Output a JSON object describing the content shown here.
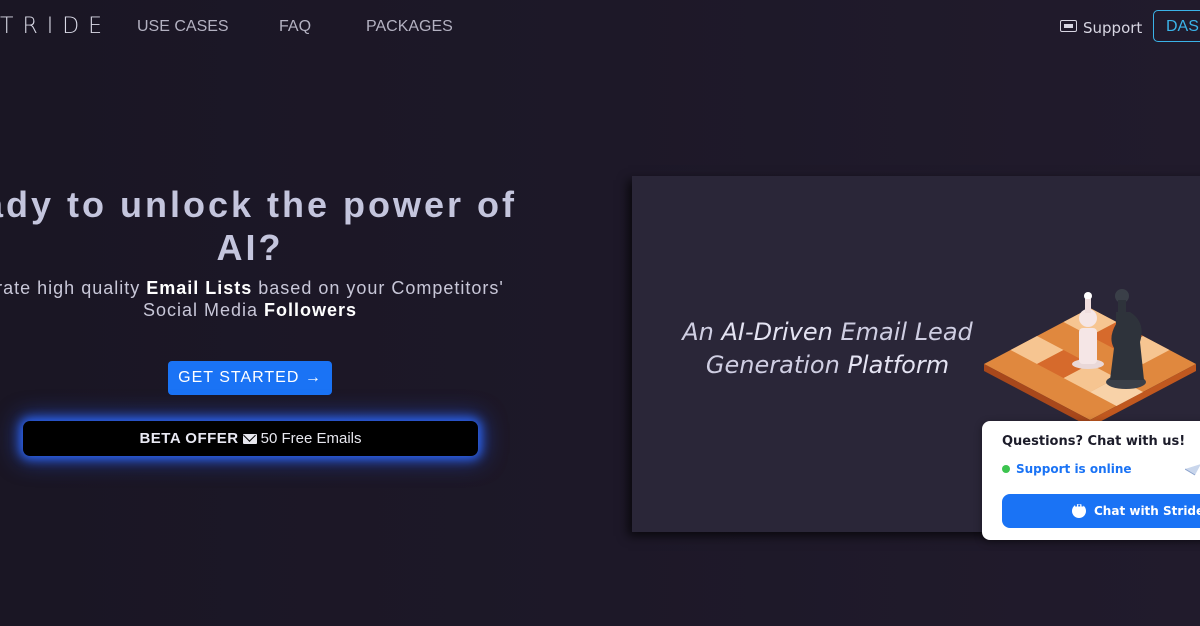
{
  "nav": {
    "logo": "TRIDE",
    "links": [
      "USE CASES",
      "FAQ",
      "PACKAGES"
    ],
    "support_label": "Support",
    "dashboard_label": "DASH"
  },
  "hero": {
    "title_line1": "ady to unlock the power of",
    "title_line2": "AI?",
    "sub_pre": "rate high quality ",
    "sub_bold1": "Email Lists",
    "sub_mid": " based on your Competitors'",
    "sub_line2_pre": "Social Media ",
    "sub_bold2": "Followers",
    "cta_label": "GET STARTED →",
    "beta_bold": "BETA OFFER",
    "beta_text": "50 Free Emails"
  },
  "card": {
    "tag_pre": "An ",
    "tag_bold1": "AI-Driven",
    "tag_mid": " Email Lead",
    "tag_line2_pre": "Generation ",
    "tag_bold2": "Platform"
  },
  "chat": {
    "title": "Questions? Chat with us!",
    "status": "Support is online",
    "button_label": "Chat with Stride"
  },
  "colors": {
    "accent": "#1a73f5",
    "cyan": "#3bb3e8",
    "online": "#3cc44f"
  }
}
